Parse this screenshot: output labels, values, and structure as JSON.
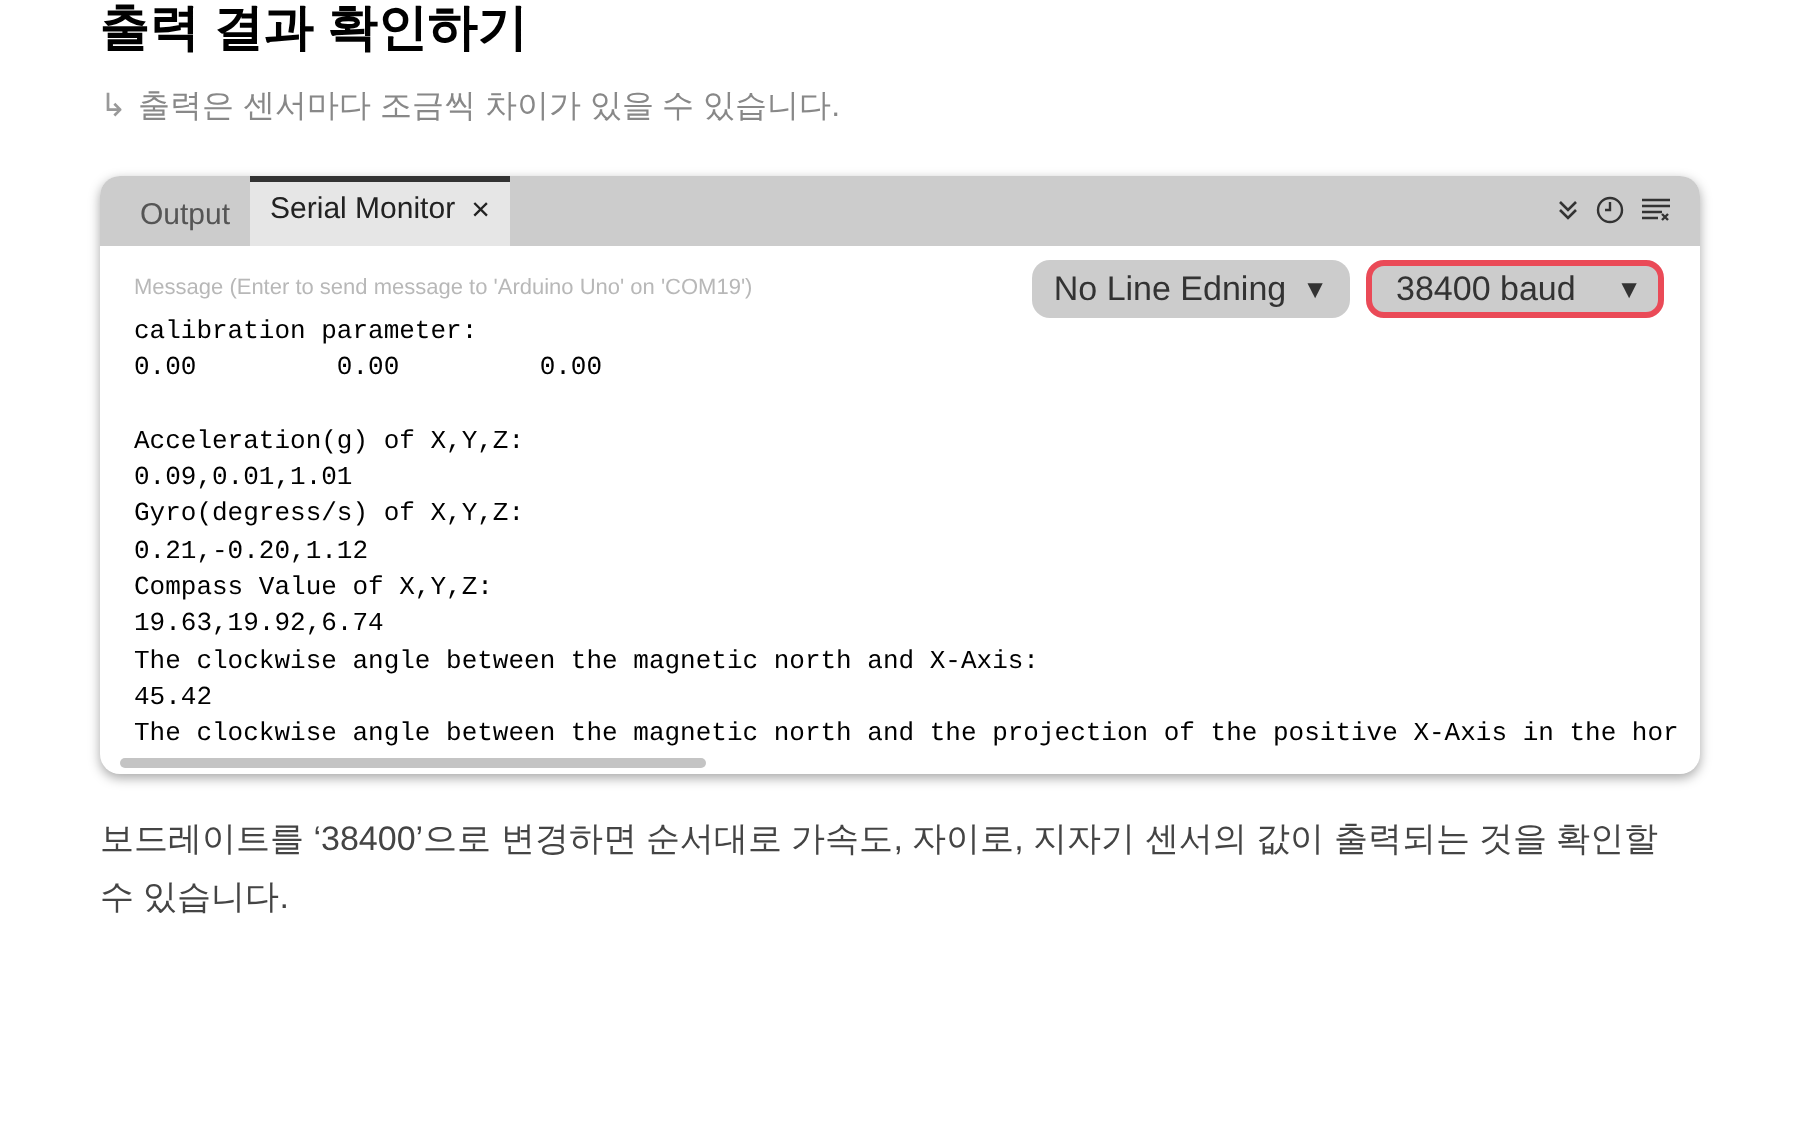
{
  "heading": "출력 결과 확인하기",
  "note": {
    "arrow": "↳",
    "text": "출력은 센서마다 조금씩 차이가 있을 수 있습니다."
  },
  "monitor": {
    "tabs": [
      {
        "label": "Output",
        "selected": false
      },
      {
        "label": "Serial Monitor",
        "selected": true,
        "close": "×"
      }
    ],
    "message": {
      "placeholder": "Message (Enter to send message to 'Arduino Uno' on 'COM19')"
    },
    "line_ending": {
      "value": "No Line Edning",
      "caret": "▼",
      "highlighted": false
    },
    "baud": {
      "value": "38400 baud",
      "caret": "▼",
      "highlighted": true
    },
    "output_blocks": [
      [
        "calibration parameter:",
        "0.00         0.00         0.00"
      ],
      [
        "Acceleration(g) of X,Y,Z:",
        "0.09,0.01,1.01",
        "Gyro(degress/s) of X,Y,Z:",
        "0.21,-0.20,1.12",
        "Compass Value of X,Y,Z:",
        "19.63,19.92,6.74",
        "The clockwise angle between the magnetic north and X-Axis:",
        "45.42",
        "The clockwise angle between the magnetic north and the projection of the positive X-Axis in the hor"
      ]
    ]
  },
  "paragraph": "보드레이트를 ‘38400’으로 변경하면 순서대로 가속도, 자이로, 지자기 센서의 값이 출력되는 것을 확인할 수 있습니다."
}
